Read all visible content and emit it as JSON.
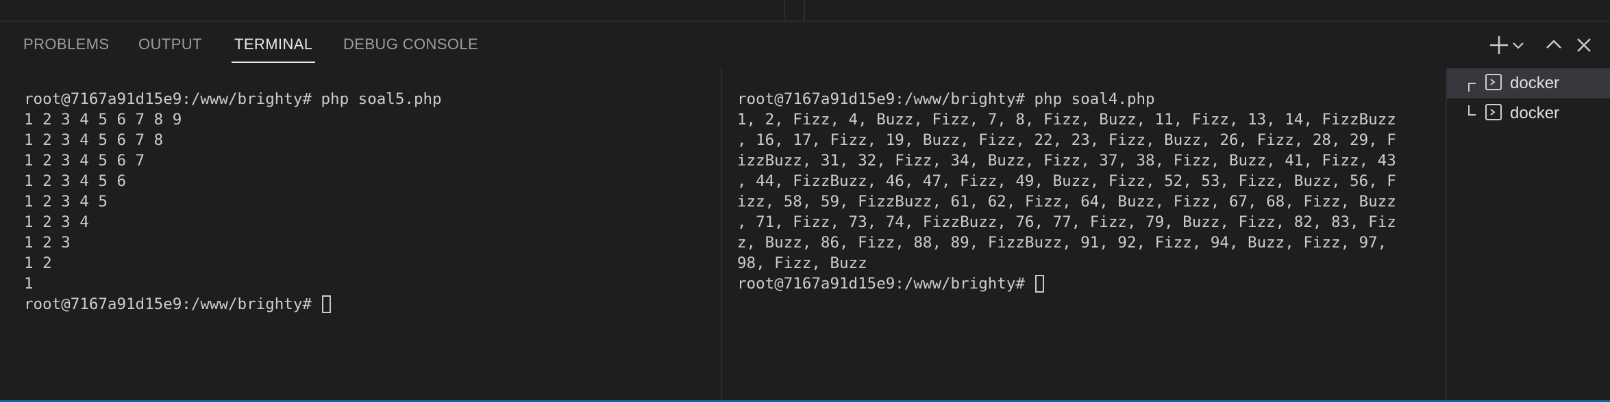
{
  "panel": {
    "tabs": [
      {
        "label": "PROBLEMS"
      },
      {
        "label": "OUTPUT"
      },
      {
        "label": "TERMINAL",
        "active": true
      },
      {
        "label": "DEBUG CONSOLE"
      }
    ],
    "actions": [
      "plus-icon",
      "chevron-down-icon",
      "chevron-up-icon",
      "close-icon"
    ]
  },
  "terminals": {
    "left": {
      "lines": [
        "root@7167a91d15e9:/www/brighty# php soal5.php",
        "1 2 3 4 5 6 7 8 9",
        "1 2 3 4 5 6 7 8",
        "1 2 3 4 5 6 7",
        "1 2 3 4 5 6",
        "1 2 3 4 5",
        "1 2 3 4",
        "1 2 3",
        "1 2",
        "1"
      ],
      "prompt": "root@7167a91d15e9:/www/brighty# "
    },
    "right": {
      "lines": [
        "root@7167a91d15e9:/www/brighty# php soal4.php",
        "1, 2, Fizz, 4, Buzz, Fizz, 7, 8, Fizz, Buzz, 11, Fizz, 13, 14, FizzBuzz",
        ", 16, 17, Fizz, 19, Buzz, Fizz, 22, 23, Fizz, Buzz, 26, Fizz, 28, 29, F",
        "izzBuzz, 31, 32, Fizz, 34, Buzz, Fizz, 37, 38, Fizz, Buzz, 41, Fizz, 43",
        ", 44, FizzBuzz, 46, 47, Fizz, 49, Buzz, Fizz, 52, 53, Fizz, Buzz, 56, F",
        "izz, 58, 59, FizzBuzz, 61, 62, Fizz, 64, Buzz, Fizz, 67, 68, Fizz, Buzz",
        ", 71, Fizz, 73, 74, FizzBuzz, 76, 77, Fizz, 79, Buzz, Fizz, 82, 83, Fiz",
        "z, Buzz, 86, Fizz, 88, 89, FizzBuzz, 91, 92, Fizz, 94, Buzz, Fizz, 97,",
        "98, Fizz, Buzz"
      ],
      "prompt": "root@7167a91d15e9:/www/brighty# "
    }
  },
  "terminal_list": [
    {
      "label": "docker",
      "icon": "terminal-icon",
      "selected": true
    },
    {
      "label": "docker",
      "icon": "terminal-icon",
      "selected": false
    }
  ]
}
